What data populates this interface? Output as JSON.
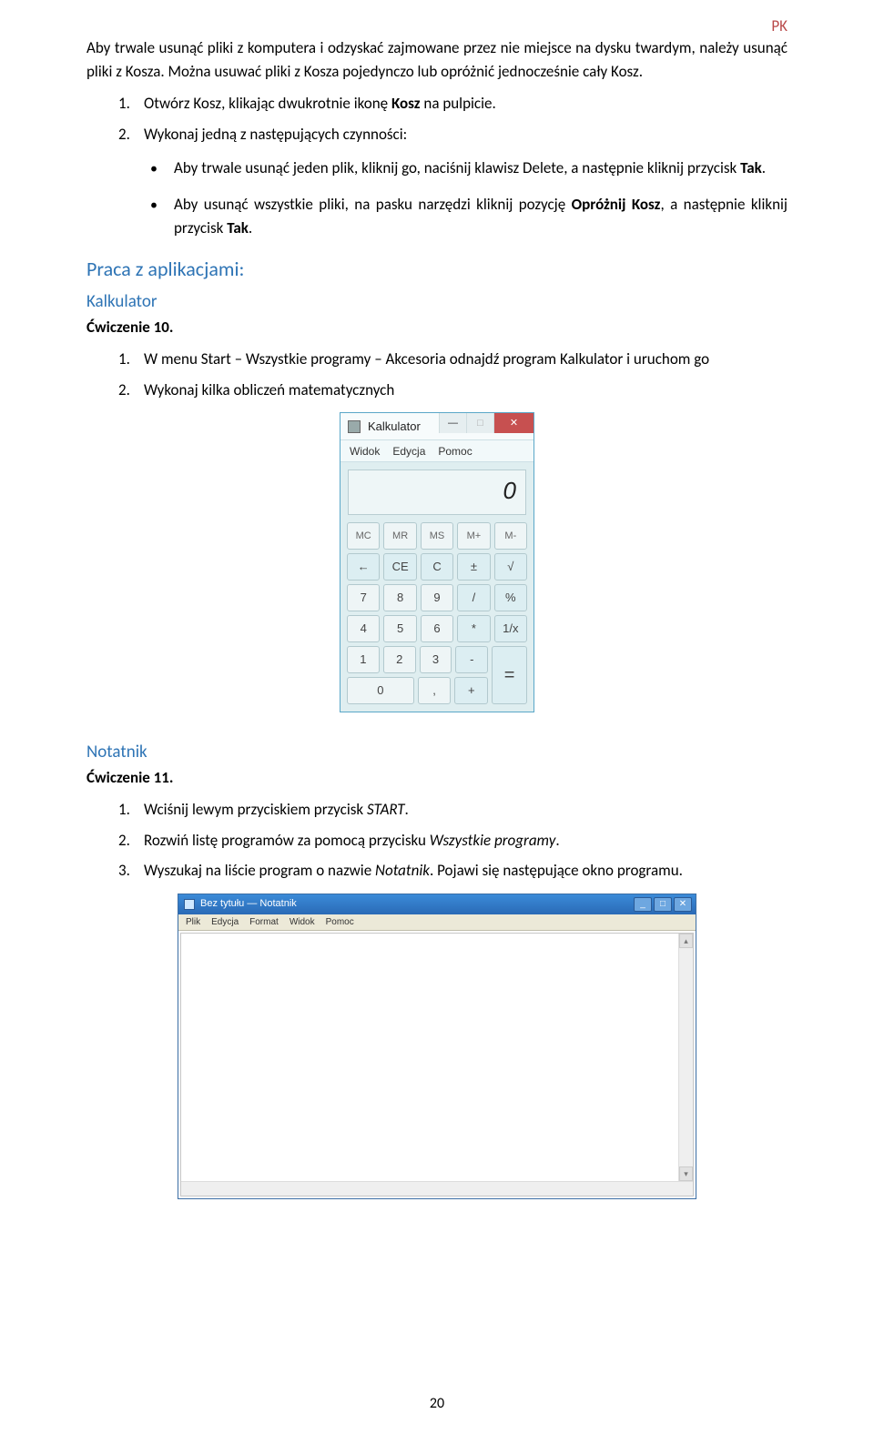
{
  "header": {
    "tag": "PK"
  },
  "intro": {
    "p1a": "Aby trwale usunąć pliki z komputera i odzyskać zajmowane przez nie miejsce na dysku twardym, należy usunąć pliki z Kosza. Można usuwać pliki z Kosza pojedynczo lub opróżnić jednocześnie cały Kosz.",
    "ol": [
      {
        "n": "1.",
        "a": "Otwórz Kosz, klikając dwukrotnie ikonę ",
        "b": "Kosz",
        "c": " na pulpicie."
      },
      {
        "n": "2.",
        "a": "Wykonaj jedną z następujących czynności:",
        "b": "",
        "c": ""
      }
    ],
    "ul": [
      {
        "a": "Aby trwale usunąć jeden plik, kliknij go, naciśnij klawisz Delete, a następnie kliknij przycisk ",
        "b": "Tak",
        "c": "."
      },
      {
        "a": "Aby usunąć wszystkie pliki, na pasku narzędzi kliknij pozycję ",
        "b": "Opróżnij Kosz",
        "c": ", a następnie kliknij przycisk ",
        "d": "Tak",
        "e": "."
      }
    ]
  },
  "section1": {
    "h1": "Praca z aplikacjami:",
    "h2": "Kalkulator",
    "ex": "Ćwiczenie 10.",
    "ol": [
      {
        "n": "1.",
        "t": "W menu Start – Wszystkie programy – Akcesoria odnajdź program Kalkulator i uruchom go"
      },
      {
        "n": "2.",
        "t": "Wykonaj kilka obliczeń matematycznych"
      }
    ]
  },
  "calc": {
    "title": "Kalkulator",
    "win": {
      "min": "—",
      "max": "□",
      "close": "✕"
    },
    "menu": [
      "Widok",
      "Edycja",
      "Pomoc"
    ],
    "display": "0",
    "rows": [
      [
        "MC",
        "MR",
        "MS",
        "M+",
        "M-"
      ],
      [
        "←",
        "CE",
        "C",
        "±",
        "√"
      ],
      [
        "7",
        "8",
        "9",
        "/",
        "%"
      ],
      [
        "4",
        "5",
        "6",
        "*",
        "1/x"
      ],
      [
        "1",
        "2",
        "3",
        "-"
      ],
      [
        "0",
        ",",
        "+"
      ]
    ],
    "eq": "="
  },
  "section2": {
    "h2": "Notatnik",
    "ex": "Ćwiczenie 11.",
    "ol": [
      {
        "n": "1.",
        "a": "Wciśnij lewym przyciskiem przycisk ",
        "i": "START",
        "b": "."
      },
      {
        "n": "2.",
        "a": "Rozwiń listę programów za pomocą przycisku ",
        "i": "Wszystkie programy",
        "b": "."
      },
      {
        "n": "3.",
        "a": "Wyszukaj na liście program o nazwie ",
        "i": "Notatnik",
        "b": ". Pojawi się następujące okno programu."
      }
    ]
  },
  "notepad": {
    "title": "Bez tytułu — Notatnik",
    "win": {
      "min": "_",
      "max": "□",
      "close": "✕"
    },
    "menu": [
      "Plik",
      "Edycja",
      "Format",
      "Widok",
      "Pomoc"
    ]
  },
  "page": "20"
}
